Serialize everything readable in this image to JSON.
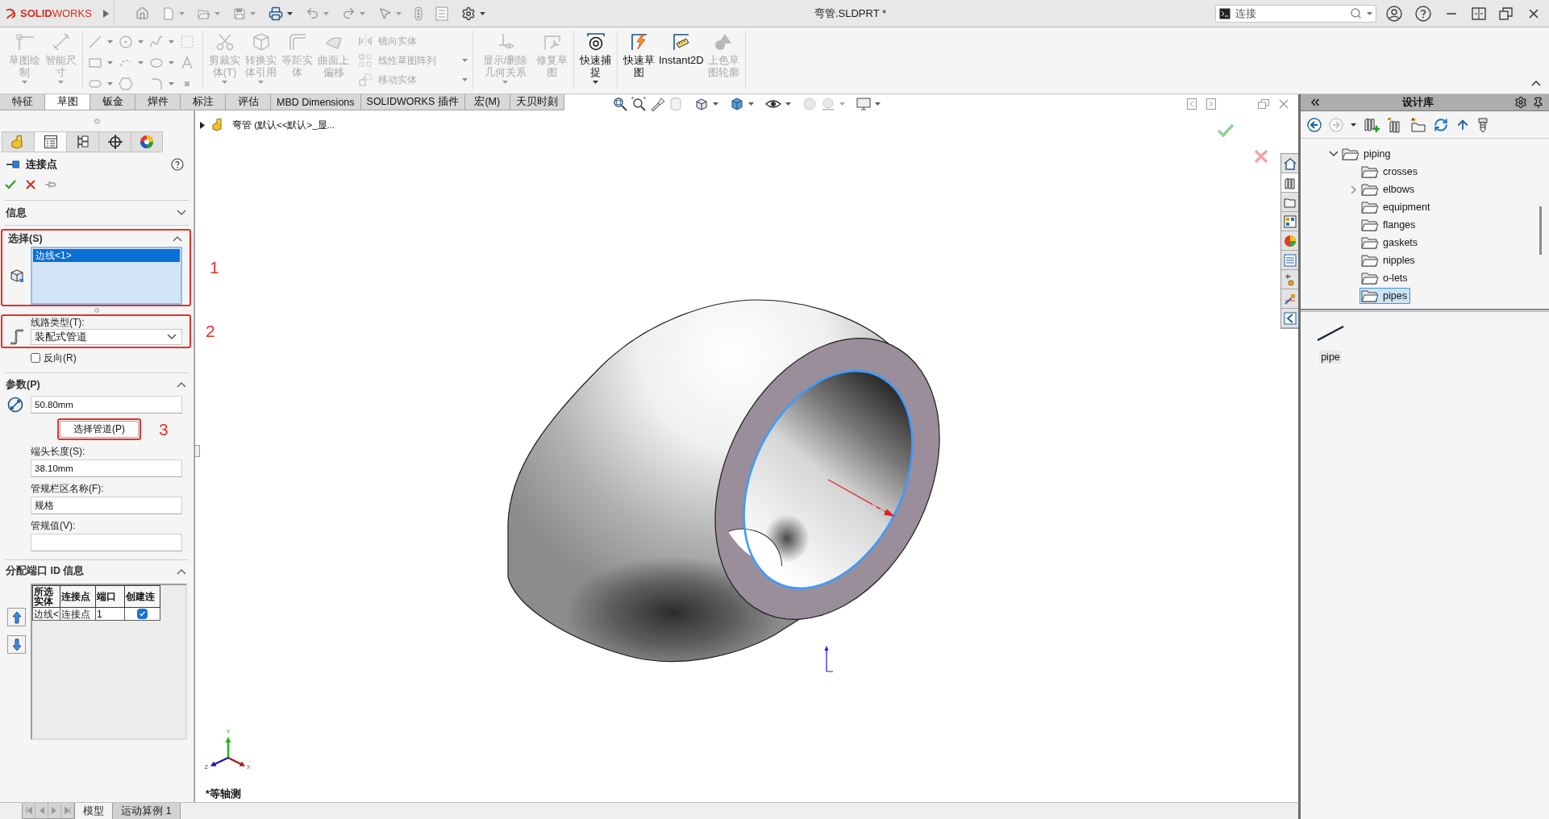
{
  "title_bar": {
    "logo": "**SOLID**WORKS",
    "document_title": "弯管.SLDPRT *",
    "search": {
      "value": "连接"
    }
  },
  "ribbon": {
    "groups": [
      {
        "kind": "buttons",
        "items": [
          {
            "kind": "large",
            "label": "草图绘制",
            "disabled": true,
            "dropdown": true
          },
          {
            "kind": "large",
            "label": "智能尺寸",
            "disabled": true,
            "dropdown": true
          }
        ]
      },
      {
        "kind": "sketch_tools"
      },
      {
        "kind": "buttons",
        "items": [
          {
            "kind": "large",
            "label": "剪裁实体(T)",
            "disabled": true,
            "dropdown": true
          },
          {
            "kind": "large",
            "label": "转换实体引用",
            "disabled": true,
            "dropdown": true
          },
          {
            "kind": "large",
            "label": "等距实体",
            "disabled": true,
            "dropdown": false
          },
          {
            "kind": "large",
            "label": "曲面上偏移",
            "disabled": true,
            "dropdown": false
          },
          {
            "kind": "stack",
            "items": [
              {
                "label": "镜向实体",
                "disabled": true,
                "dropdown": false
              },
              {
                "label": "线性草图阵列",
                "disabled": true,
                "dropdown": true
              },
              {
                "label": "移动实体",
                "disabled": true,
                "dropdown": true
              }
            ]
          }
        ]
      },
      {
        "kind": "buttons",
        "items": [
          {
            "kind": "large",
            "label": "显示/删除几何关系",
            "disabled": true,
            "dropdown": true
          },
          {
            "kind": "large",
            "label": "修复草图",
            "disabled": true,
            "dropdown": false
          }
        ]
      },
      {
        "kind": "buttons",
        "items": [
          {
            "kind": "large",
            "label": "快速捕捉",
            "disabled": false,
            "dropdown": true
          }
        ]
      },
      {
        "kind": "buttons",
        "items": [
          {
            "kind": "large",
            "label": "快速草图",
            "disabled": false,
            "dropdown": false
          },
          {
            "kind": "large",
            "label": "Instant2D",
            "disabled": false,
            "dropdown": false
          },
          {
            "kind": "large",
            "label": "上色草图轮廓",
            "disabled": true,
            "dropdown": false
          }
        ]
      }
    ]
  },
  "command_tabs": [
    {
      "label": "特征",
      "selected": false
    },
    {
      "label": "草图",
      "selected": true
    },
    {
      "label": "钣金",
      "selected": false
    },
    {
      "label": "焊件",
      "selected": false
    },
    {
      "label": "标注",
      "selected": false
    },
    {
      "label": "评估",
      "selected": false
    },
    {
      "label": "MBD Dimensions",
      "selected": false
    },
    {
      "label": "SOLIDWORKS 插件",
      "selected": false
    },
    {
      "label": "宏(M)",
      "selected": false
    },
    {
      "label": "天贝时刻",
      "selected": false
    }
  ],
  "property_manager": {
    "tabs": [
      {
        "selected": false
      },
      {
        "selected": true
      },
      {
        "selected": false
      },
      {
        "selected": false
      },
      {
        "selected": false
      }
    ],
    "title": "连接点",
    "info": {
      "title": "信息",
      "expanded": false
    },
    "selection": {
      "title": "选择(S)",
      "expanded": true,
      "callout": "1",
      "items": [
        {
          "label": "边线<1>",
          "selected": true
        }
      ]
    },
    "route_type": {
      "label": "线路类型(T):",
      "value": "装配式管道",
      "callout": "2"
    },
    "reverse": {
      "label": "反向(R)",
      "checked": false
    },
    "parameters": {
      "title": "参数(P)",
      "expanded": true,
      "diameter": "50.80mm",
      "select_button": {
        "label": "选择管道(P)",
        "callout": "3"
      },
      "fields": [
        {
          "label": "端头长度(S):",
          "value": "38.10mm"
        },
        {
          "label": "管规栏区名称(F):",
          "value": "规格"
        },
        {
          "label": "管规值(V):"
        }
      ]
    },
    "port_section": {
      "title": "分配端口 ID 信息",
      "expanded": true,
      "columns": [
        "所选实体",
        "连接点",
        "端口",
        "创建连"
      ],
      "rows": [
        {
          "cells": [
            "边线<",
            "连接点",
            "1"
          ],
          "create_connection": true
        }
      ]
    }
  },
  "viewport": {
    "feature_tree_root": "弯管 (默认<<默认>_显...",
    "view_name": "*等轴测",
    "triad": {
      "x": "X",
      "y": "Y",
      "z": "Z"
    }
  },
  "task_pane_tabs": [
    {
      "selected": false
    },
    {
      "selected": true
    },
    {
      "selected": false
    },
    {
      "selected": false
    },
    {
      "selected": false
    },
    {
      "selected": false
    },
    {
      "selected": false
    },
    {
      "selected": false
    },
    {
      "selected": false
    }
  ],
  "design_library": {
    "title": "设计库",
    "tree": [
      {
        "label": "piping",
        "expanded": true,
        "selected": false,
        "children": [
          {
            "label": "crosses",
            "expandable": false,
            "selected": false
          },
          {
            "label": "elbows",
            "expandable": true,
            "selected": false
          },
          {
            "label": "equipment",
            "expandable": false,
            "selected": false
          },
          {
            "label": "flanges",
            "expandable": false,
            "selected": false
          },
          {
            "label": "gaskets",
            "expandable": false,
            "selected": false
          },
          {
            "label": "nipples",
            "expandable": false,
            "selected": false
          },
          {
            "label": "o-lets",
            "expandable": false,
            "selected": false
          },
          {
            "label": "pipes",
            "expandable": false,
            "selected": true
          }
        ]
      }
    ],
    "preview": [
      {
        "label": "pipe"
      }
    ]
  },
  "bottom_tabs": [
    {
      "label": "模型",
      "selected": true
    },
    {
      "label": "运动算例 1",
      "selected": false
    }
  ]
}
